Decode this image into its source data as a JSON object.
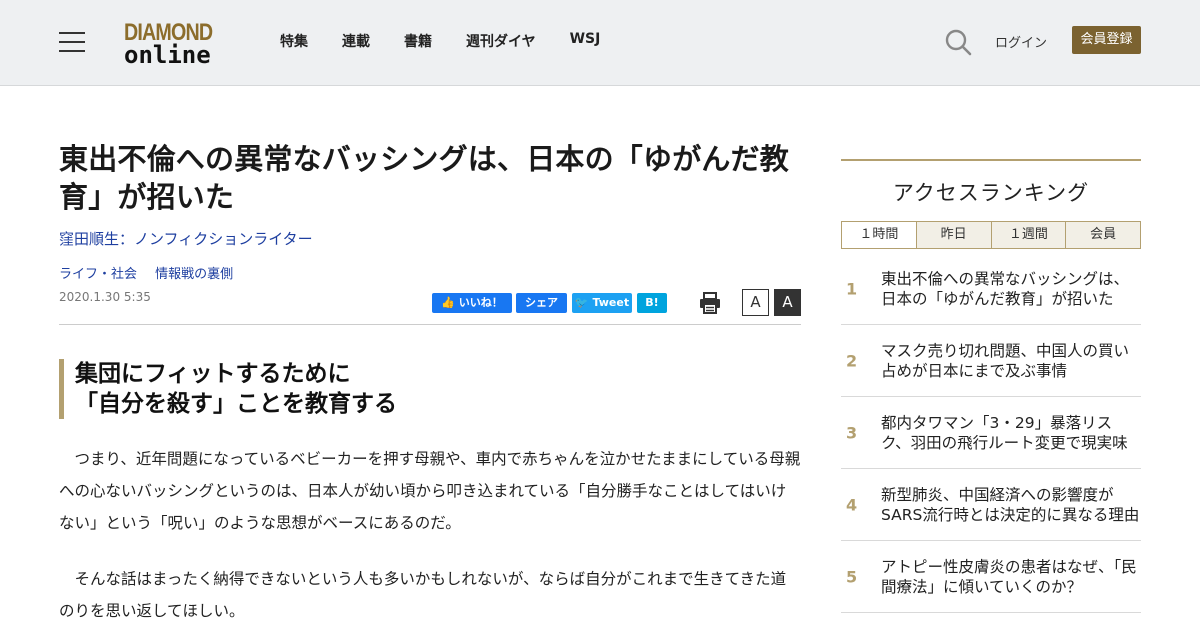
{
  "header": {
    "logo_top": "DIAMOND",
    "logo_bottom": "online",
    "nav": [
      "特集",
      "連載",
      "書籍",
      "週刊ダイヤ",
      "WSJ"
    ],
    "login": "ログイン",
    "register": "会員登録"
  },
  "article": {
    "title": "東出不倫への異常なバッシングは、日本の「ゆがんだ教育」が招いた",
    "author": "窪田順生：ノンフィクションライター",
    "tags": [
      "ライフ・社会",
      "情報戦の裏側"
    ],
    "date": "2020.1.30 5:35",
    "share": {
      "like": "いいね！",
      "share": "シェア",
      "tweet": "Tweet",
      "hatena": "B!"
    },
    "font_small": "A",
    "font_large": "A",
    "subhead": [
      "集団にフィットするために",
      "「自分を殺す」ことを教育する"
    ],
    "paragraphs": [
      "つまり、近年問題になっているベビーカーを押す母親や、車内で赤ちゃんを泣かせたままにしている母親への心ないバッシングというのは、日本人が幼い頃から叩き込まれている「自分勝手なことはしてはいけない」という「呪い」のような思想がベースにあるのだ。",
      "そんな話はまったく納得できないという人も多いかもしれないが、ならば自分がこれまで生きてきた道のりを思い返してほしい。"
    ]
  },
  "ranking": {
    "title": "アクセスランキング",
    "tabs": [
      "１時間",
      "昨日",
      "１週間",
      "会員"
    ],
    "items": [
      {
        "num": "1",
        "text": "東出不倫への異常なバッシングは、日本の「ゆがんだ教育」が招いた"
      },
      {
        "num": "2",
        "text": "マスク売り切れ問題、中国人の買い占めが日本にまで及ぶ事情"
      },
      {
        "num": "3",
        "text": "都内タワマン「3・29」暴落リスク、羽田の飛行ルート変更で現実味"
      },
      {
        "num": "4",
        "text": "新型肺炎、中国経済への影響度がSARS流行時とは決定的に異なる理由"
      },
      {
        "num": "5",
        "text": "アトピー性皮膚炎の患者はなぜ、「民間療法」に傾いていくのか？"
      }
    ]
  },
  "colors": {
    "accent_gold": "#b3a070",
    "register_bg": "#7b6230",
    "link_blue": "#1e3fa0",
    "facebook": "#1877f2",
    "twitter": "#1da1f2",
    "hatena": "#00a4de"
  },
  "icons": [
    "hamburger-icon",
    "search-icon",
    "print-icon",
    "facebook-like-icon",
    "twitter-icon"
  ]
}
